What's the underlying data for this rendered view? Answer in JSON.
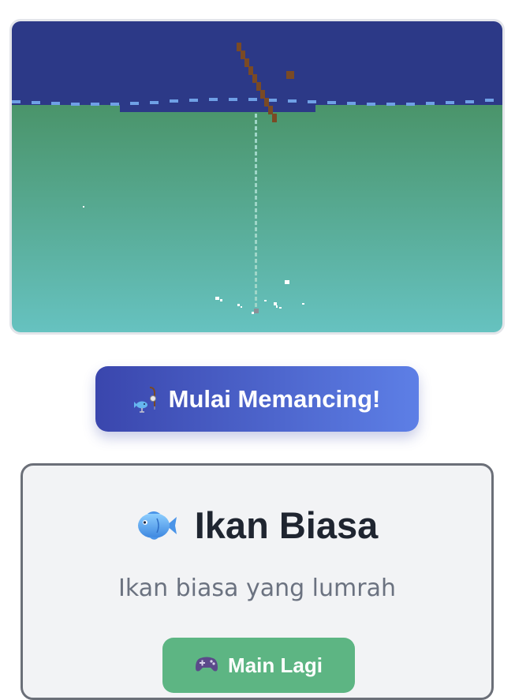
{
  "game": {
    "sky_color": "#2c3987",
    "water_top_color": "#4a946a",
    "water_bottom_color": "#66c2c0",
    "wave_color": "#6fa0e6",
    "rod_color": "#7a4a25",
    "line_color": "#9fd6c8"
  },
  "start_button": {
    "label": "Mulai Memancing!",
    "icon": "fishing-rod-icon"
  },
  "result": {
    "icon": "fish-icon",
    "title": "Ikan Biasa",
    "description": "Ikan biasa yang lumrah",
    "play_again_icon": "gamepad-icon",
    "play_again_label": "Main Lagi"
  }
}
